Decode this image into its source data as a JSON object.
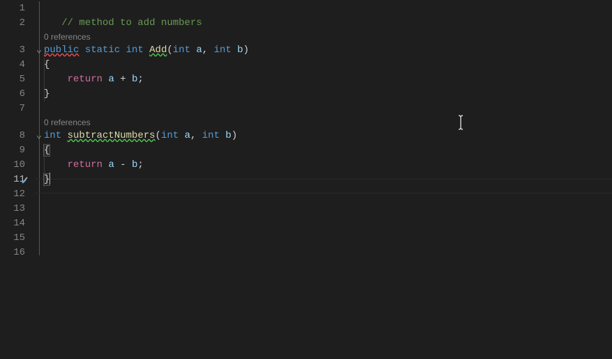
{
  "gutter": {
    "lines": [
      "1",
      "2",
      "3",
      "4",
      "5",
      "6",
      "7",
      "8",
      "9",
      "10",
      "11",
      "12",
      "13",
      "14",
      "15",
      "16"
    ],
    "active_line": 11
  },
  "codelens": {
    "add_refs": "0 references",
    "sub_refs": "0 references"
  },
  "code": {
    "line1": "",
    "line2_comment": "// method to add numbers",
    "line3": {
      "public": "public",
      "static": "static",
      "int": "int",
      "method": "Add",
      "open": "(",
      "int2": "int",
      "a": "a",
      "comma": ",",
      "int3": "int",
      "b": "b",
      "close": ")"
    },
    "brace_open": "{",
    "brace_close": "}",
    "line5": {
      "return": "return",
      "a": "a",
      "plus": "+",
      "b": "b",
      "semi": ";"
    },
    "line8": {
      "int": "int",
      "method": "subtractNumbers",
      "open": "(",
      "int2": "int",
      "a": "a",
      "comma": ",",
      "int3": "int",
      "b": "b",
      "close": ")"
    },
    "line10": {
      "return": "return",
      "a": "a",
      "minus": "-",
      "b": "b",
      "semi": ";"
    }
  },
  "icons": {
    "fold": "⌄",
    "brush": "brush"
  },
  "colors": {
    "background": "#1e1e1e",
    "comment": "#6a9955",
    "keyword": "#569cd6",
    "method": "#dcdcaa",
    "variable": "#9cdcfe",
    "control": "#d16d9e",
    "punctuation": "#d4d4d4",
    "linenumber": "#858585",
    "ruler": "#5a5a2f"
  }
}
